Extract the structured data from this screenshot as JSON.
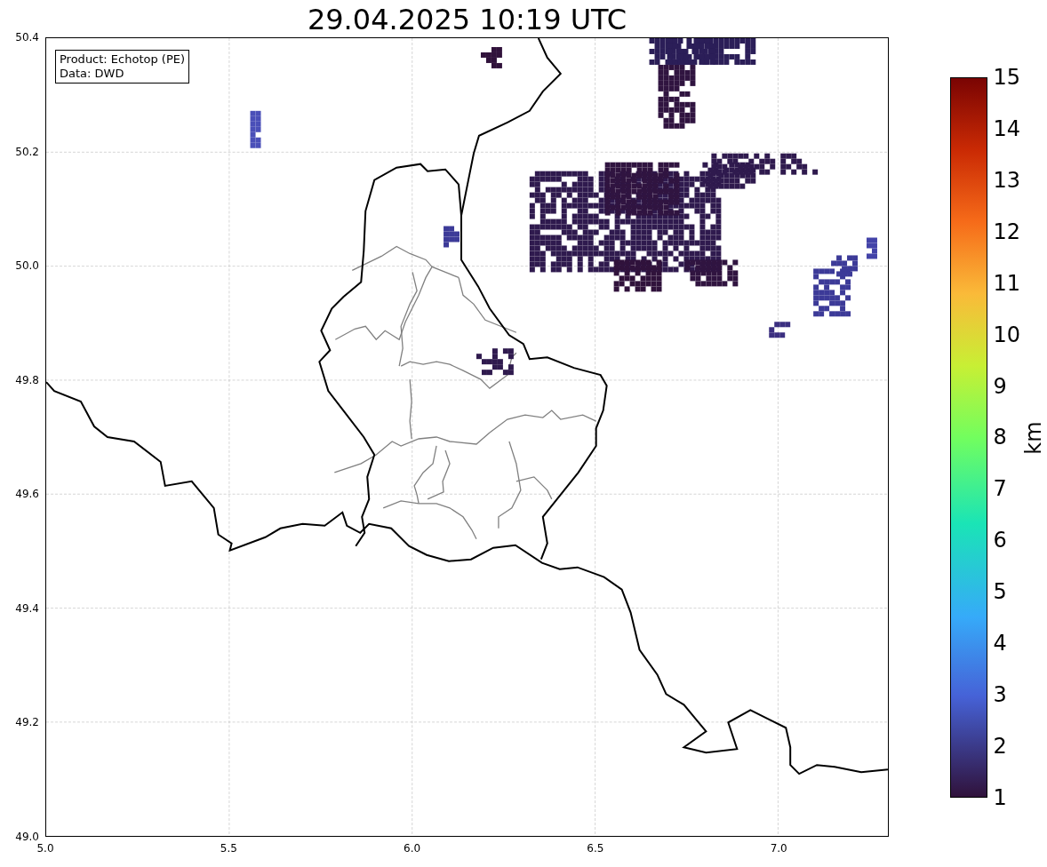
{
  "title": "29.04.2025 10:19 UTC",
  "legend": {
    "lines": [
      "Product: Echotop (PE)",
      "Data: DWD"
    ]
  },
  "y_ticks": [
    "50.4",
    "50.2",
    "50.0",
    "49.8",
    "49.6",
    "49.4",
    "49.2",
    "49.0"
  ],
  "x_ticks": [
    "5.0",
    "5.5",
    "6.0",
    "6.5",
    "7.0"
  ],
  "colorbar": {
    "label": "km",
    "ticks": [
      "15",
      "14",
      "13",
      "12",
      "11",
      "10",
      "9",
      "8",
      "7",
      "6",
      "5",
      "4",
      "3",
      "2",
      "1"
    ]
  }
}
